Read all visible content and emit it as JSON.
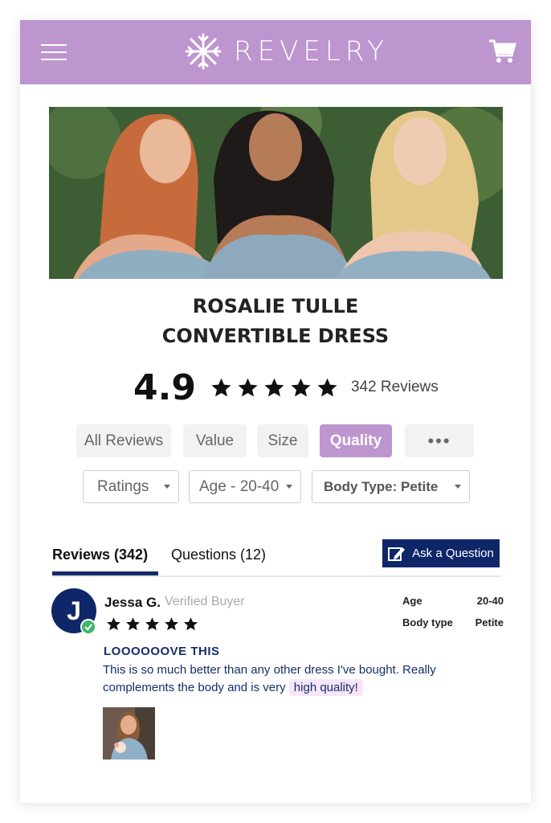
{
  "header": {
    "brand": "REVELRY",
    "accent_color": "#bd95cf"
  },
  "icons": {
    "menu": "hamburger-icon",
    "logo": "snowflake-logo",
    "cart": "cart-icon"
  },
  "product": {
    "title_line1": "ROSALIE TULLE",
    "title_line2": "CONVERTIBLE DRESS",
    "rating": "4.9",
    "stars": 5,
    "review_count_label": "342 Reviews"
  },
  "filters": {
    "tags": [
      "All Reviews",
      "Value",
      "Size",
      "Quality",
      "•••"
    ],
    "active_tag": "Quality",
    "dropdowns": [
      "Ratings",
      "Age - 20-40",
      "Body Type: Petite"
    ]
  },
  "tabs": {
    "reviews": "Reviews (342)",
    "questions": "Questions (12)",
    "ask_button": "Ask a Question"
  },
  "review": {
    "initial": "J",
    "name": "Jessa G.",
    "badge": "Verified Buyer",
    "stars": 5,
    "age_label": "Age",
    "age_value": "20-40",
    "body_label": "Body type",
    "body_value": "Petite",
    "title": "LOOOOOOVE THIS",
    "body_part1": "This is so much better than any other dress I've bought. Really complements the body and is very ",
    "body_highlight": "high quality!"
  }
}
